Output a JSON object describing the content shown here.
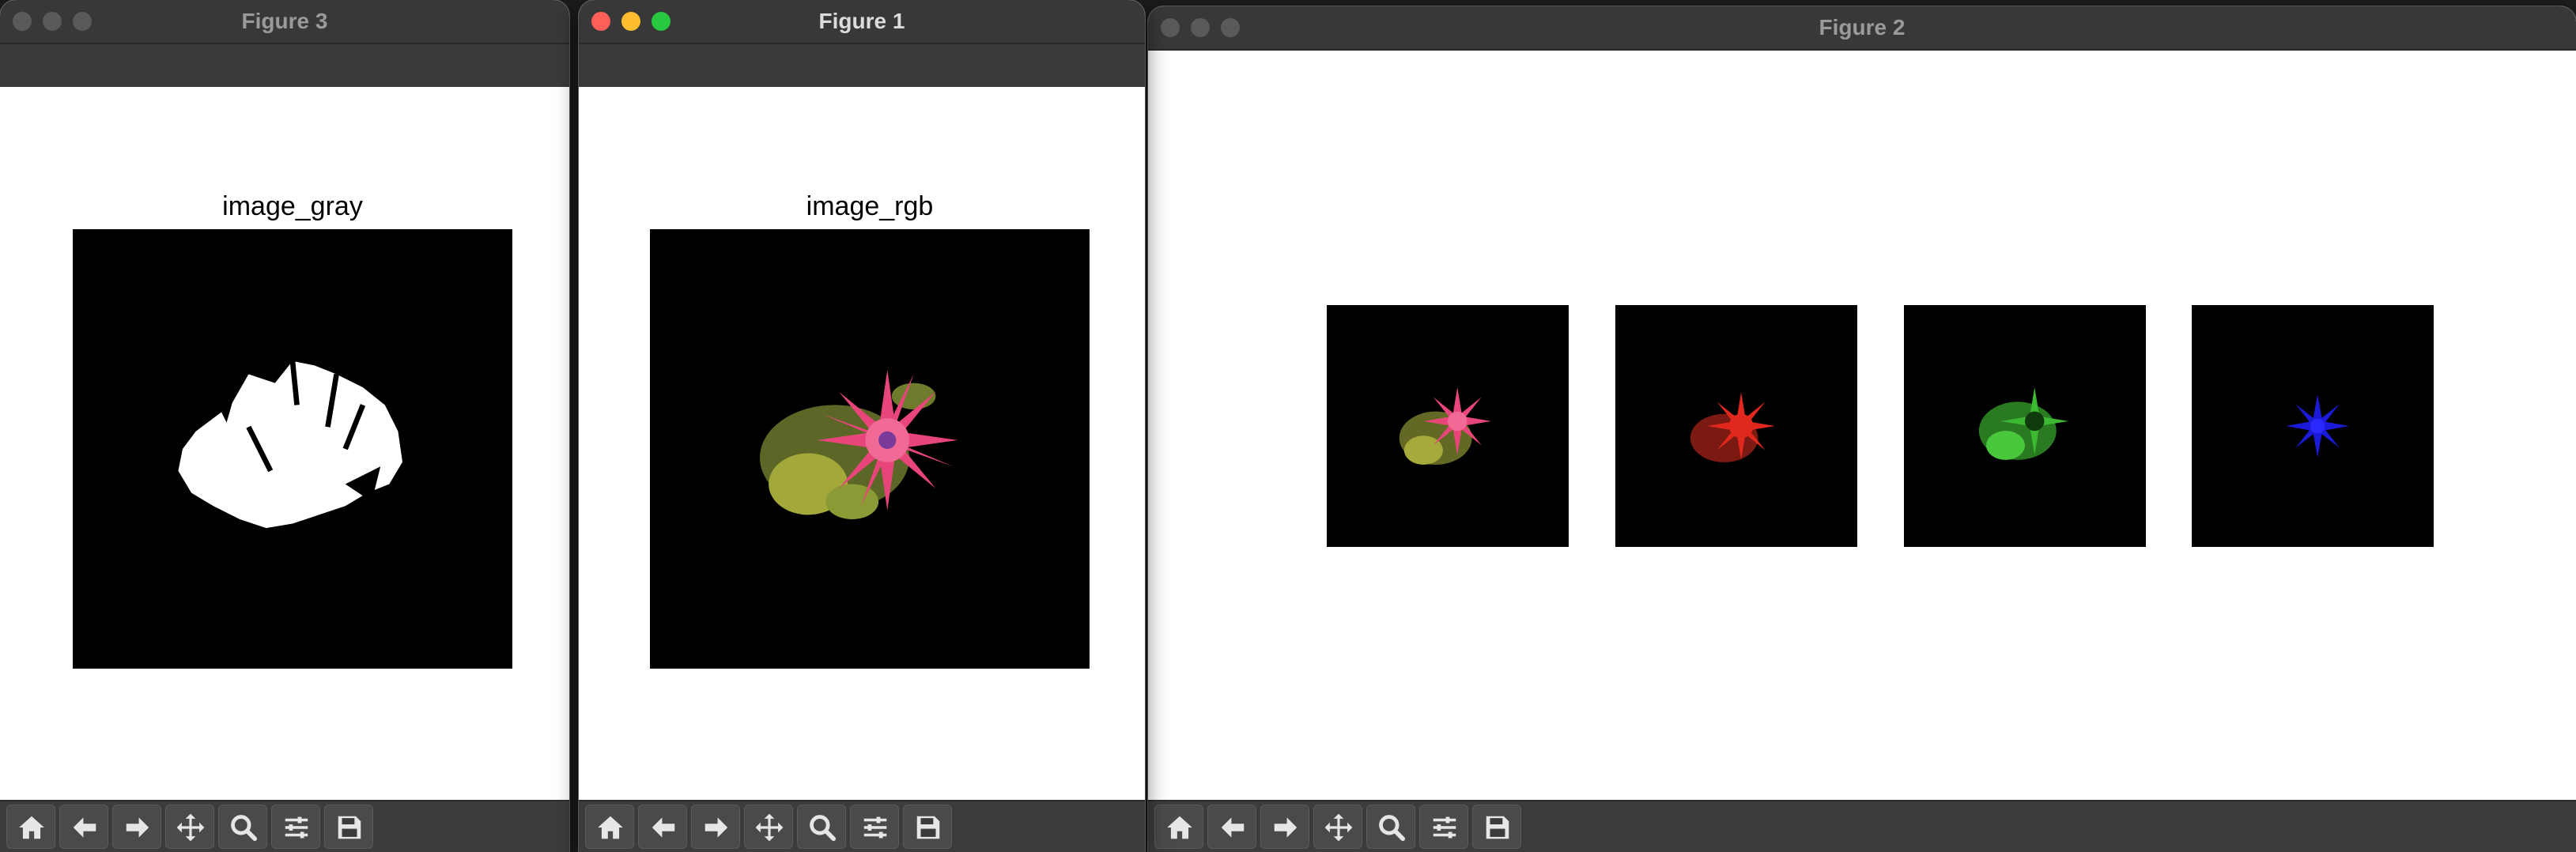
{
  "windows": {
    "figure3": {
      "title": "Figure 3",
      "axes_title": "image_gray"
    },
    "figure1": {
      "title": "Figure 1",
      "axes_title": "image_rgb"
    },
    "figure2": {
      "title": "Figure 2"
    }
  },
  "toolbar_buttons": [
    "home-icon",
    "back-arrow-icon",
    "forward-arrow-icon",
    "pan-icon",
    "zoom-icon",
    "configure-subplots-icon",
    "save-icon"
  ],
  "colors": {
    "titlebar": "#383838",
    "toolbar": "#3c3c3c",
    "close": "#ff5f57",
    "minimize": "#febc2e",
    "zoom": "#28c840",
    "flower_pink": "#e8457a",
    "channel_red": "#e0281e",
    "channel_green": "#3cb832",
    "channel_blue": "#1a1ad8"
  }
}
